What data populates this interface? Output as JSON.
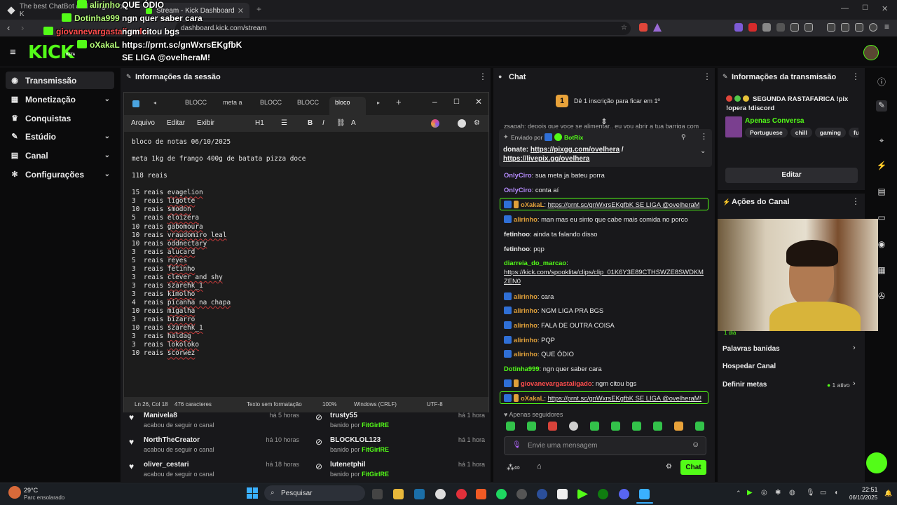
{
  "browser": {
    "tabs": [
      {
        "label": "The best ChatBot and Widgets for K"
      },
      {
        "label": "Stream - Kick Dashboard"
      }
    ],
    "url": "dashboard.kick.com/stream"
  },
  "brand": {
    "logo": "KICK",
    "beta": "BETA"
  },
  "overlay": [
    {
      "user": "alirinho",
      "msg": "QUE ÓDIO"
    },
    {
      "user": "Dotinha999",
      "msg": "ngn quer saber cara"
    },
    {
      "user": "giovanevargastaligado",
      "msg": "ngm citou bgs"
    },
    {
      "user": "oXakaL",
      "msg": "https://prnt.sc/gnWxrsEKgfbK"
    },
    {
      "user": "",
      "msg": "SE LIGA @ovelheraM!"
    }
  ],
  "sidebar": {
    "items": [
      {
        "label": "Transmissão",
        "icon": "broadcast-icon"
      },
      {
        "label": "Monetização",
        "icon": "dollar-icon"
      },
      {
        "label": "Conquistas",
        "icon": "trophy-icon"
      },
      {
        "label": "Estúdio",
        "icon": "studio-icon"
      },
      {
        "label": "Canal",
        "icon": "channel-icon"
      },
      {
        "label": "Configurações",
        "icon": "gear-icon"
      }
    ]
  },
  "session_panel": {
    "title": "Informações da sessão"
  },
  "notepad": {
    "tabs": [
      "BLOCC",
      "meta a",
      "BLOCC",
      "BLOCC",
      "bloco"
    ],
    "menu": [
      "Arquivo",
      "Editar",
      "Exibir"
    ],
    "heading_style": "H1",
    "lines": [
      "bloco de notas 06/10/2025",
      "",
      "meta 1kg de frango 400g de batata pizza doce",
      "",
      "118 reais",
      "",
      "15 reais evagelion",
      "3  reais ligotte",
      "10 reais smodon",
      "5  reais eloizera",
      "10 reais gabomoura",
      "10 reais vraudomiro leal",
      "10 reais oddnectary",
      "3  reais alucard",
      "5  reais reyes",
      "3  reais fetinho",
      "3  reais clever and shy",
      "3  reais szarehk_1",
      "3  reais kimolho",
      "4  reais picanha na chapa",
      "10 reais migalha",
      "3  reais bizarro",
      "10 reais szarehk_1",
      "3  reais haldag",
      "3  reais lokoloko",
      "10 reais scorwez"
    ],
    "status": {
      "pos": "Ln 26, Col 18",
      "chars": "476 caracteres",
      "format": "Texto sem formatação",
      "zoom": "100%",
      "eol": "Windows (CRLF)",
      "enc": "UTF-8"
    }
  },
  "follows": [
    {
      "name": "Manivela8",
      "sub": "acabou de seguir o canal",
      "time": "há 5 horas"
    },
    {
      "name": "NorthTheCreator",
      "sub": "acabou de seguir o canal",
      "time": "há 10 horas"
    },
    {
      "name": "oliver_cestari",
      "sub": "acabou de seguir o canal",
      "time": "há 18 horas"
    }
  ],
  "bans": [
    {
      "name": "trusty55",
      "sub_prefix": "banido por",
      "by": "FitGirlRE",
      "time": "há 1 hora"
    },
    {
      "name": "BLOCKLOL123",
      "sub_prefix": "banido por",
      "by": "FitGirlRE",
      "time": "há 1 hora"
    },
    {
      "name": "lutenetphil",
      "sub_prefix": "banido por",
      "by": "FitGirlRE",
      "time": "há 1 hora"
    }
  ],
  "chat": {
    "title": "Chat",
    "sub_banner": "Dê 1 inscrição para ficar em 1º",
    "sub_rank": "1",
    "cut_line": "zsagah: depois que voce se alimentar.. eu vou abrir a tua barriga com",
    "pinned": {
      "label": "Enviado por",
      "bot": "BotRix",
      "prefix": "donate:",
      "link1": "https://pixgg.com/ovelhera",
      "sep": "/",
      "link2": "https://livepix.gg/ovelhera"
    },
    "messages": [
      {
        "user": "OnlyCiro",
        "color": "#b68cff",
        "text": "sua meta ja bateu porra"
      },
      {
        "user": "OnlyCiro",
        "color": "#b68cff",
        "text": "conta aí"
      },
      {
        "user": "oXakaL",
        "color": "#e0a03a",
        "text": "https://prnt.sc/gnWxrsEKgfbK SE LIGA @ovelheraM",
        "hl": true
      },
      {
        "user": "alirinho",
        "color": "#e0a03a",
        "text": "man mas eu sinto que cabe mais comida no porco"
      },
      {
        "user": "fetinhoo",
        "color": "#e8e8e8",
        "text": "ainda ta falando disso"
      },
      {
        "user": "fetinhoo",
        "color": "#e8e8e8",
        "text": "pqp"
      },
      {
        "user": "diarreia_do_marcao",
        "color": "#53fc18",
        "text": "https://kick.com/spooklita/clips/clip_01K6Y3E89CTHSWZE8SWDKMZEN0"
      },
      {
        "user": "alirinho",
        "color": "#e0a03a",
        "text": "cara"
      },
      {
        "user": "alirinho",
        "color": "#e0a03a",
        "text": "NGM LIGA PRA BGS"
      },
      {
        "user": "alirinho",
        "color": "#e0a03a",
        "text": "FALA DE OUTRA COISA"
      },
      {
        "user": "alirinho",
        "color": "#e0a03a",
        "text": "PQP"
      },
      {
        "user": "alirinho",
        "color": "#e0a03a",
        "text": "QUE ÓDIO"
      },
      {
        "user": "Dotinha999",
        "color": "#53fc18",
        "text": "ngn quer saber cara"
      },
      {
        "user": "giovanevargastaligado",
        "color": "#ff4d4d",
        "text": "ngm citou bgs"
      },
      {
        "user": "oXakaL",
        "color": "#e0a03a",
        "text": "https://prnt.sc/gnWxrsEKgfbK SE LIGA @ovelheraM!",
        "hl": true
      }
    ],
    "followers_only": "Apenas seguidores",
    "placeholder": "Envie uma mensagem",
    "send": "Chat"
  },
  "stream_info": {
    "title": "Informações da transmissão",
    "stream_title": "SEGUNDA RASTAFARICA !pix !opera !discord",
    "category": "Apenas Conversa",
    "tags": [
      "Portuguese",
      "chill",
      "gaming",
      "funny"
    ],
    "edit": "Editar"
  },
  "channel_actions": {
    "title": "Ações do Canal",
    "day_label": "1 dia",
    "items": [
      {
        "label": "Palavras banidas"
      },
      {
        "label": "Hospedar Canal"
      },
      {
        "label": "Definir metas",
        "status": "1 ativo"
      }
    ]
  },
  "taskbar": {
    "weather_temp": "29°C",
    "weather_desc": "Parc ensolarado",
    "search": "Pesquisar",
    "time": "22:51",
    "date": "06/10/2025"
  },
  "colors": {
    "brand": "#53fc18",
    "panel": "#18181b",
    "bg": "#0b0b0c"
  }
}
